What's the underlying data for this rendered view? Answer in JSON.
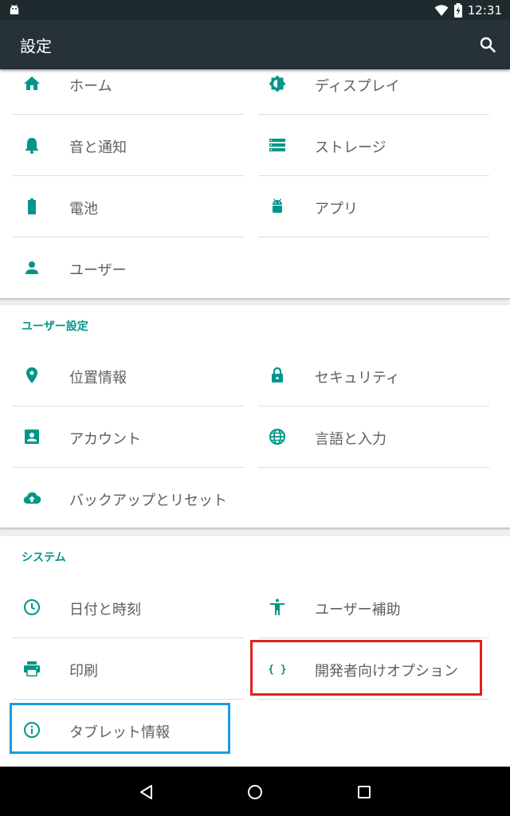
{
  "status_bar": {
    "time": "12:31"
  },
  "toolbar": {
    "title": "設定",
    "search_icon": "search-icon"
  },
  "accent_color": "#009688",
  "device_section": {
    "items": [
      {
        "label": "ホーム",
        "icon": "home-icon"
      },
      {
        "label": "ディスプレイ",
        "icon": "brightness-icon"
      },
      {
        "label": "音と通知",
        "icon": "bell-icon"
      },
      {
        "label": "ストレージ",
        "icon": "storage-icon"
      },
      {
        "label": "電池",
        "icon": "battery-icon"
      },
      {
        "label": "アプリ",
        "icon": "android-icon"
      },
      {
        "label": "ユーザー",
        "icon": "person-icon"
      }
    ]
  },
  "user_section": {
    "header": "ユーザー設定",
    "items": [
      {
        "label": "位置情報",
        "icon": "location-pin-icon"
      },
      {
        "label": "セキュリティ",
        "icon": "lock-icon"
      },
      {
        "label": "アカウント",
        "icon": "account-box-icon"
      },
      {
        "label": "言語と入力",
        "icon": "globe-icon"
      },
      {
        "label": "バックアップとリセット",
        "icon": "cloud-upload-icon"
      }
    ]
  },
  "system_section": {
    "header": "システム",
    "items": [
      {
        "label": "日付と時刻",
        "icon": "clock-icon"
      },
      {
        "label": "ユーザー補助",
        "icon": "accessibility-icon"
      },
      {
        "label": "印刷",
        "icon": "printer-icon"
      },
      {
        "label": "開発者向けオプション",
        "icon": "braces-icon"
      },
      {
        "label": "タブレット情報",
        "icon": "info-icon"
      }
    ]
  },
  "nav_bar": {
    "back": "back-icon",
    "home": "home-circle-icon",
    "recents": "recents-icon"
  },
  "highlight_colors": {
    "red": "#e02020",
    "blue": "#1e9be0"
  }
}
